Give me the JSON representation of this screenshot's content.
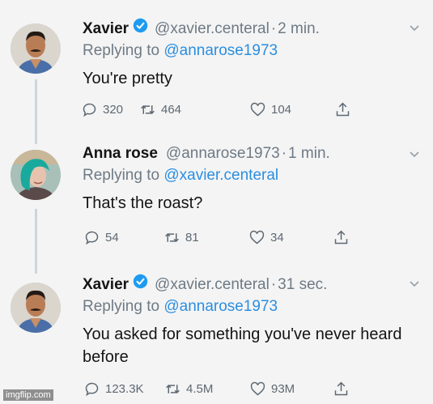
{
  "tweets": [
    {
      "name": "Xavier",
      "verified": true,
      "handle": "@xavier.centeral",
      "time": "2 min.",
      "replying_prefix": "Replying to ",
      "replying_to": "@annarose1973",
      "text": "You're pretty",
      "counts": {
        "replies": "320",
        "retweets": "464",
        "likes": "104"
      }
    },
    {
      "name": "Anna rose",
      "verified": false,
      "handle": "@annarose1973",
      "time": "1 min.",
      "replying_prefix": "Replying to ",
      "replying_to": "@xavier.centeral",
      "text": "That's the roast?",
      "counts": {
        "replies": "54",
        "retweets": "81",
        "likes": "34"
      }
    },
    {
      "name": "Xavier",
      "verified": true,
      "handle": "@xavier.centeral",
      "time": "31 sec.",
      "replying_prefix": "Replying to ",
      "replying_to": "@annarose1973",
      "text": "You asked for something you've never heard before",
      "counts": {
        "replies": "123.3K",
        "retweets": "4.5M",
        "likes": "93M"
      }
    }
  ],
  "separator": "·",
  "watermark": "imgflip.com",
  "colors": {
    "verified": "#1d9bf0",
    "mention": "#2b8ee0",
    "meta": "#6e7a85"
  },
  "icons": [
    "verified-badge-icon",
    "reply-icon",
    "retweet-icon",
    "like-icon",
    "share-icon",
    "chevron-down-icon"
  ]
}
